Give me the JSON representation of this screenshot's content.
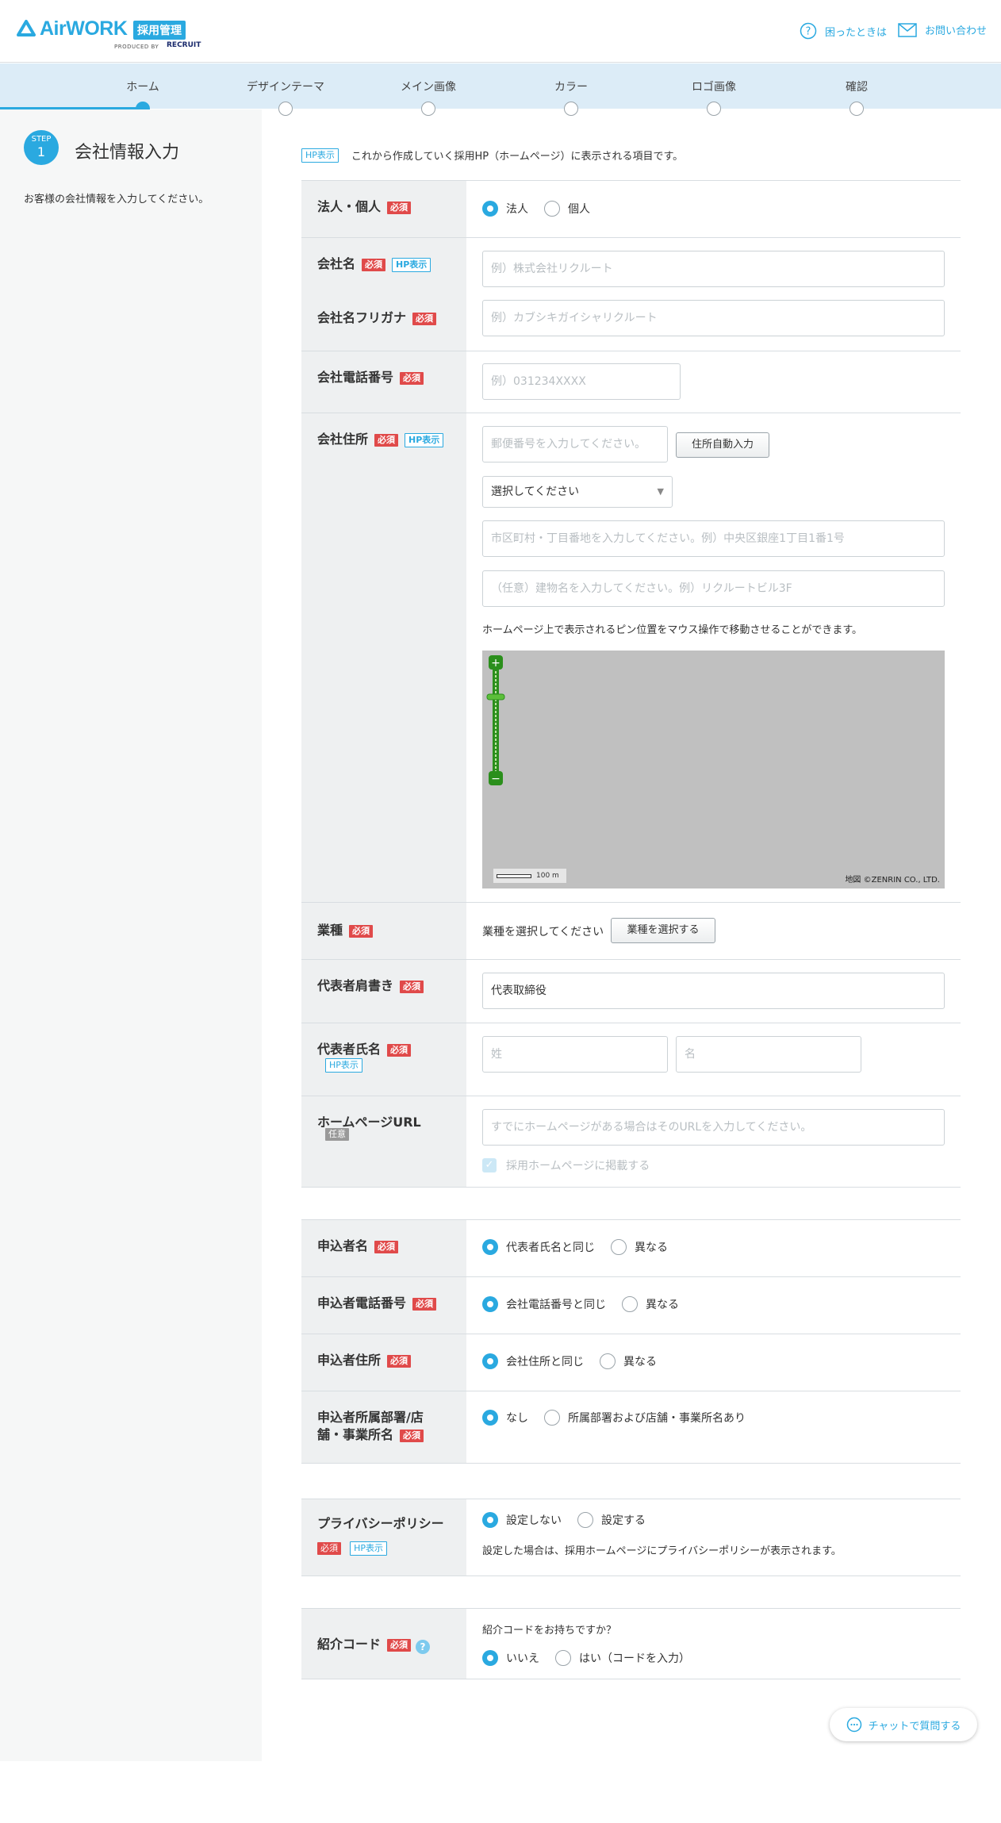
{
  "header": {
    "logo_word": "AirWORK",
    "logo_badge": "採用管理",
    "logo_sub": "PRODUCED BY",
    "logo_recruit": "RECRUIT",
    "help_label": "困ったときは",
    "contact_label": "お問い合わせ"
  },
  "steps": [
    "ホーム",
    "デザインテーマ",
    "メイン画像",
    "カラー",
    "ロゴ画像",
    "確認"
  ],
  "sidebar": {
    "step_word": "STEP",
    "step_num": "1",
    "title": "会社情報入力",
    "description": "お客様の会社情報を入力してください。"
  },
  "tags": {
    "hp": "HP表示",
    "required": "必須",
    "optional": "任意"
  },
  "intro_text": "これから作成していく採用HP（ホームページ）に表示される項目です。",
  "form": {
    "entity": {
      "label": "法人・個人",
      "options": [
        "法人",
        "個人"
      ]
    },
    "company_name": {
      "label": "会社名",
      "placeholder": "例）株式会社リクルート"
    },
    "company_kana": {
      "label": "会社名フリガナ",
      "placeholder": "例）カブシキガイシャリクルート"
    },
    "phone": {
      "label": "会社電話番号",
      "placeholder": "例）031234XXXX"
    },
    "address": {
      "label": "会社住所",
      "postal_placeholder": "郵便番号を入力してください。",
      "auto_button": "住所自動入力",
      "pref_select": "選択してください",
      "city_placeholder": "市区町村・丁目番地を入力してください。例）中央区銀座1丁目1番1号",
      "building_placeholder": "（任意）建物名を入力してください。例）リクルートビル3F",
      "map_note": "ホームページ上で表示されるピン位置をマウス操作で移動させることができます。",
      "map_scale": "100 m",
      "map_copyright": "地図 ©ZENRIN CO., LTD."
    },
    "industry": {
      "label": "業種",
      "text": "業種を選択してください",
      "button": "業種を選択する"
    },
    "rep_title": {
      "label": "代表者肩書き",
      "value": "代表取締役"
    },
    "rep_name": {
      "label": "代表者氏名",
      "last_placeholder": "姓",
      "first_placeholder": "名"
    },
    "homepage": {
      "label": "ホームページURL",
      "placeholder": "すでにホームページがある場合はそのURLを入力してください。",
      "checkbox_label": "採用ホームページに掲載する"
    },
    "applicant_name": {
      "label": "申込者名",
      "options": [
        "代表者氏名と同じ",
        "異なる"
      ]
    },
    "applicant_phone": {
      "label": "申込者電話番号",
      "options": [
        "会社電話番号と同じ",
        "異なる"
      ]
    },
    "applicant_address": {
      "label": "申込者住所",
      "options": [
        "会社住所と同じ",
        "異なる"
      ]
    },
    "applicant_dept": {
      "label_line1": "申込者所属部署/店",
      "label_line2": "舗・事業所名",
      "options": [
        "なし",
        "所属部署および店舗・事業所名あり"
      ]
    },
    "privacy": {
      "label": "プライバシーポリシー",
      "options": [
        "設定しない",
        "設定する"
      ],
      "note": "設定した場合は、採用ホームページにプライバシーポリシーが表示されます。"
    },
    "referral": {
      "label": "紹介コード",
      "question": "紹介コードをお持ちですか？",
      "options": [
        "いいえ",
        "はい（コードを入力）"
      ]
    }
  },
  "chat_label": "チャットで質問する",
  "colors": {
    "accent": "#2aa9e0",
    "required": "#e04a4a",
    "label_bg": "#eef0f1"
  }
}
